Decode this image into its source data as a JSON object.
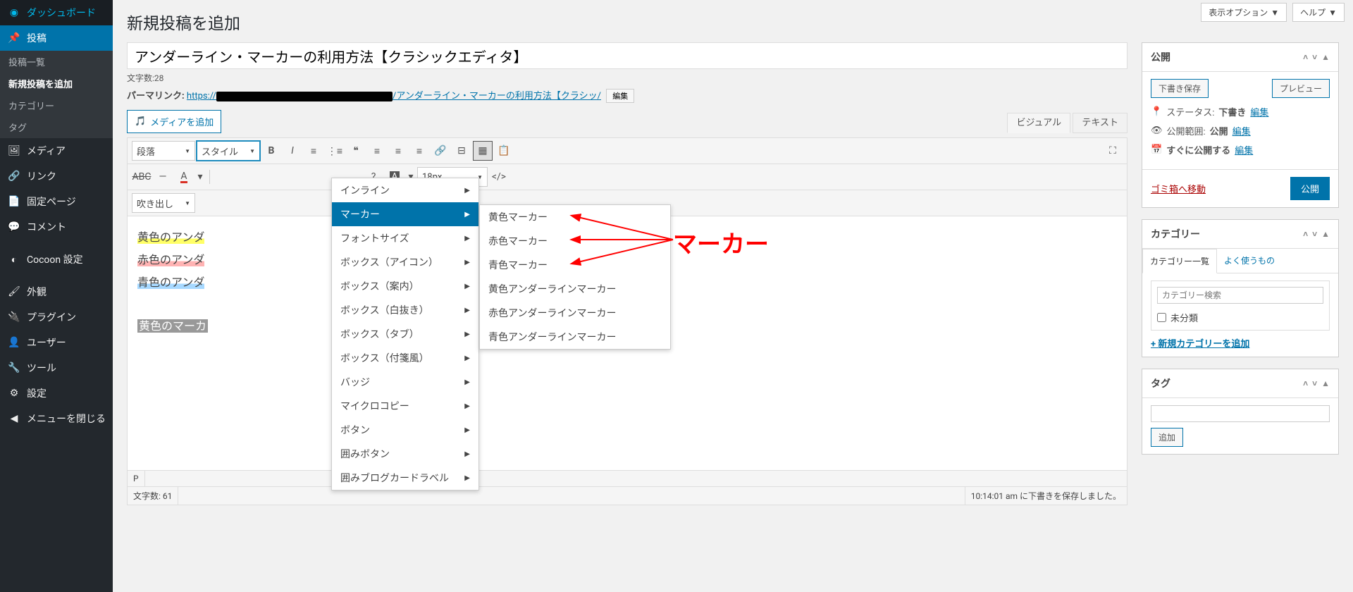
{
  "top": {
    "display_options": "表示オプション",
    "help": "ヘルプ"
  },
  "sidebar": {
    "items": [
      {
        "label": "ダッシュボード",
        "icon": "dashboard"
      },
      {
        "label": "投稿",
        "icon": "pin"
      },
      {
        "label": "メディア",
        "icon": "media"
      },
      {
        "label": "リンク",
        "icon": "link"
      },
      {
        "label": "固定ページ",
        "icon": "page"
      },
      {
        "label": "コメント",
        "icon": "comment"
      },
      {
        "label": "Cocoon 設定",
        "icon": "cocoon"
      },
      {
        "label": "外観",
        "icon": "brush"
      },
      {
        "label": "プラグイン",
        "icon": "plugin"
      },
      {
        "label": "ユーザー",
        "icon": "user"
      },
      {
        "label": "ツール",
        "icon": "tool"
      },
      {
        "label": "設定",
        "icon": "settings"
      },
      {
        "label": "メニューを閉じる",
        "icon": "collapse"
      }
    ],
    "sub": [
      {
        "label": "投稿一覧"
      },
      {
        "label": "新規投稿を追加"
      },
      {
        "label": "カテゴリー"
      },
      {
        "label": "タグ"
      }
    ]
  },
  "page_title": "新規投稿を追加",
  "post_title": "アンダーライン・マーカーの利用方法【クラシックエディタ】",
  "char_count_label": "文字数:28",
  "permalink": {
    "label": "パーマリンク:",
    "prefix": "https://",
    "slug": "/アンダーライン・マーカーの利用方法【クラシッ/",
    "edit": "編集"
  },
  "media_btn": "メディアを追加",
  "editor_tabs": {
    "visual": "ビジュアル",
    "text": "テキスト"
  },
  "toolbar": {
    "paragraph": "段落",
    "style": "スタイル",
    "speech": "吹き出し",
    "fontsize": "18px"
  },
  "style_menu": [
    "インライン",
    "マーカー",
    "フォントサイズ",
    "ボックス（アイコン）",
    "ボックス（案内）",
    "ボックス（白抜き）",
    "ボックス（タブ）",
    "ボックス（付箋風）",
    "バッジ",
    "マイクロコピー",
    "ボタン",
    "囲みボタン",
    "囲みブログカードラベル"
  ],
  "marker_submenu": [
    "黄色マーカー",
    "赤色マーカー",
    "青色マーカー",
    "黄色アンダーラインマーカー",
    "赤色アンダーラインマーカー",
    "青色アンダーラインマーカー"
  ],
  "annotation_label": "マーカー",
  "content_lines": [
    {
      "text": "黄色のアンダ",
      "class": "hl-yellow"
    },
    {
      "text": "赤色のアンダ",
      "class": "hl-red"
    },
    {
      "text": "青色のアンダ",
      "class": "hl-blue"
    },
    {
      "text": "黄色のマーカ",
      "class": "hl-gray"
    }
  ],
  "status_bar": {
    "path": "P",
    "word_count": "文字数: 61",
    "saved": "10:14:01 am に下書きを保存しました。"
  },
  "publish": {
    "title": "公開",
    "save_draft": "下書き保存",
    "preview": "プレビュー",
    "status_label": "ステータス:",
    "status_value": "下書き",
    "visibility_label": "公開範囲:",
    "visibility_value": "公開",
    "schedule_label": "すぐに公開する",
    "edit": "編集",
    "trash": "ゴミ箱へ移動",
    "publish_btn": "公開"
  },
  "category": {
    "title": "カテゴリー",
    "tabs": [
      "カテゴリー一覧",
      "よく使うもの"
    ],
    "search_placeholder": "カテゴリー検索",
    "uncat": "未分類",
    "add_new": "+ 新規カテゴリーを追加"
  },
  "tag": {
    "title": "タグ",
    "add": "追加"
  }
}
